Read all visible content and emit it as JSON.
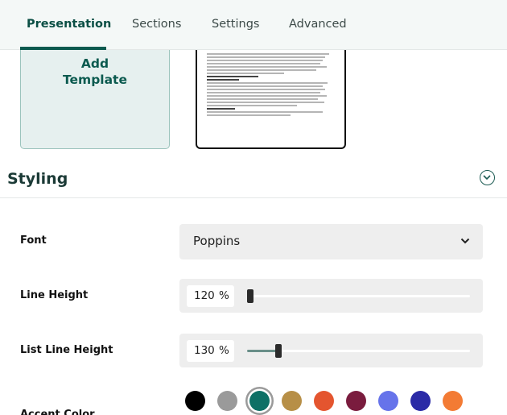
{
  "tabs": [
    {
      "label": "Presentation",
      "active": true
    },
    {
      "label": "Sections",
      "active": false
    },
    {
      "label": "Settings",
      "active": false
    },
    {
      "label": "Advanced",
      "active": false
    }
  ],
  "templates": {
    "add_label": "Add\nTemplate"
  },
  "styling": {
    "title": "Styling",
    "font": {
      "label": "Font",
      "value": "Poppins"
    },
    "line_height": {
      "label": "Line Height",
      "value": "120",
      "unit": "%",
      "slider_fraction": 0.0
    },
    "list_line_height": {
      "label": "List Line Height",
      "value": "130",
      "unit": "%",
      "slider_fraction": 0.13
    },
    "accent_color": {
      "label": "Accent Color",
      "colors": [
        "#000000",
        "#9a9a9a",
        "#0e7066",
        "#b78f47",
        "#e4552f",
        "#7a1c3e",
        "#6673ea",
        "#2a2aa6",
        "#f37b34"
      ],
      "selected_index": 2
    }
  },
  "colors": {
    "accent": "#0b5a4f"
  }
}
